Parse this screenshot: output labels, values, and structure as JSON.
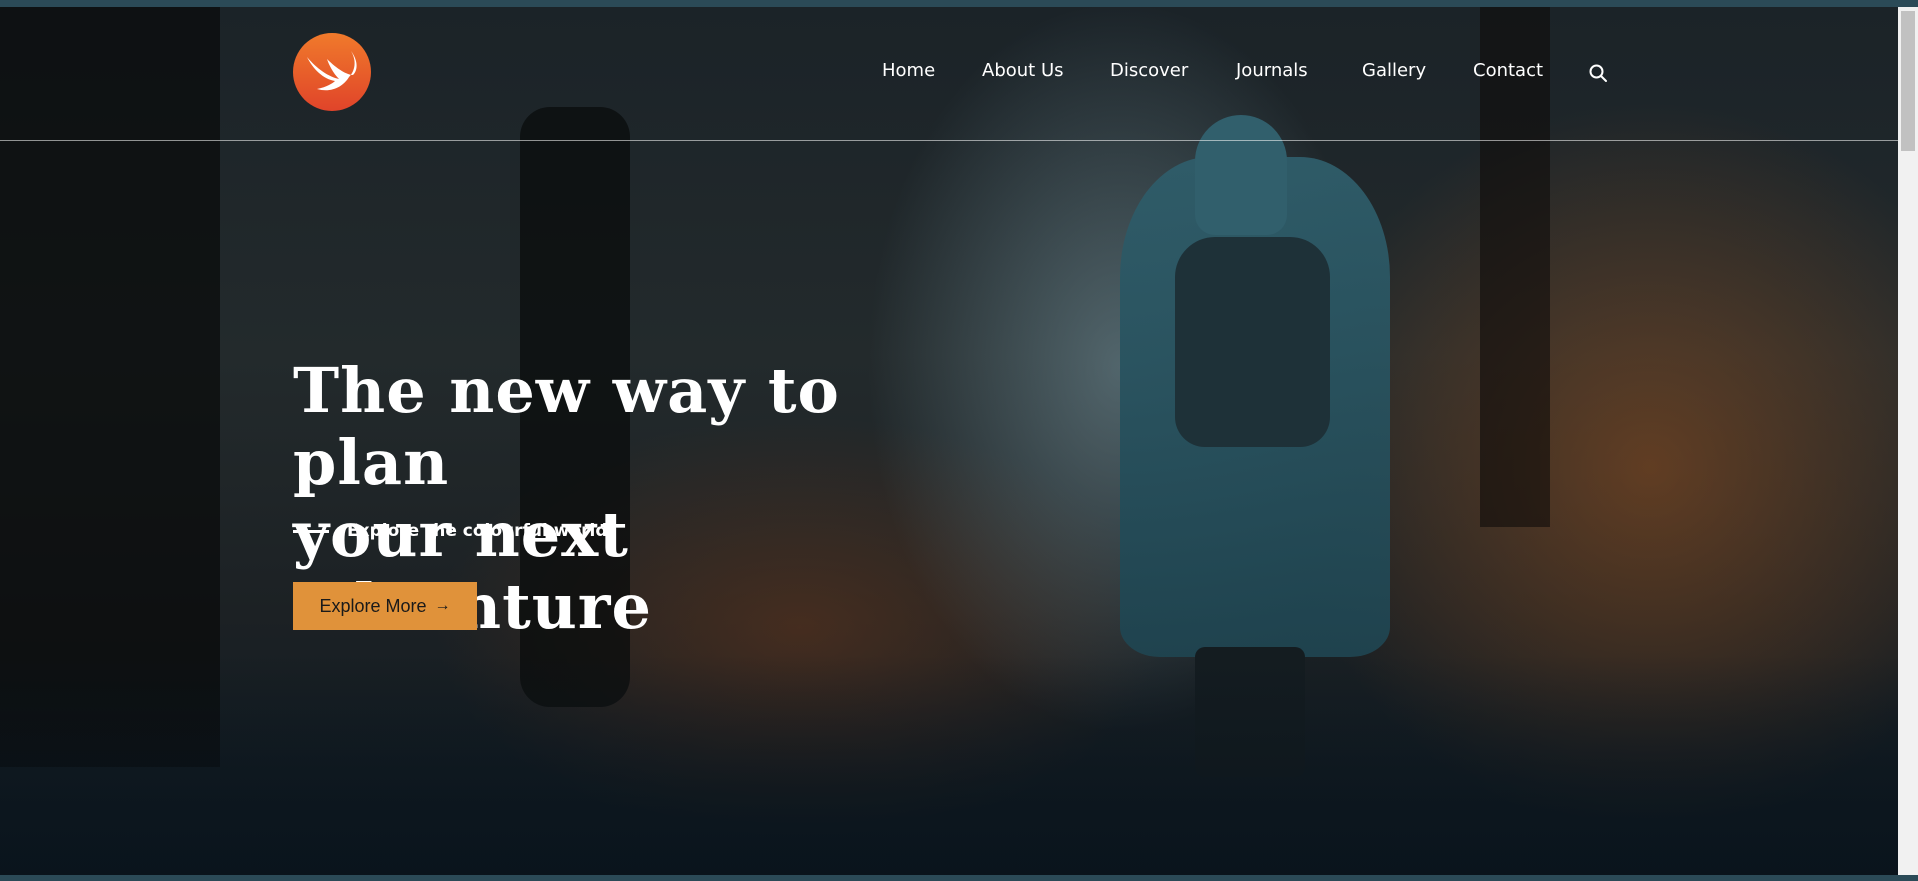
{
  "brand": {
    "logo_icon": "swift-bird-icon",
    "accent": "#e0923a"
  },
  "nav": {
    "items": [
      {
        "label": "Home"
      },
      {
        "label": "About Us"
      },
      {
        "label": "Discover"
      },
      {
        "label": "Journals"
      },
      {
        "label": "Gallery"
      },
      {
        "label": "Contact"
      }
    ],
    "search_icon": "search-icon"
  },
  "hero": {
    "headline_line1": "The new way to plan",
    "headline_line2": "your next adventure",
    "subtitle": "Explore the colourful world",
    "cta_label": "Explore More",
    "cta_icon": "arrow-right-icon",
    "cta_color": "#e0923a"
  }
}
